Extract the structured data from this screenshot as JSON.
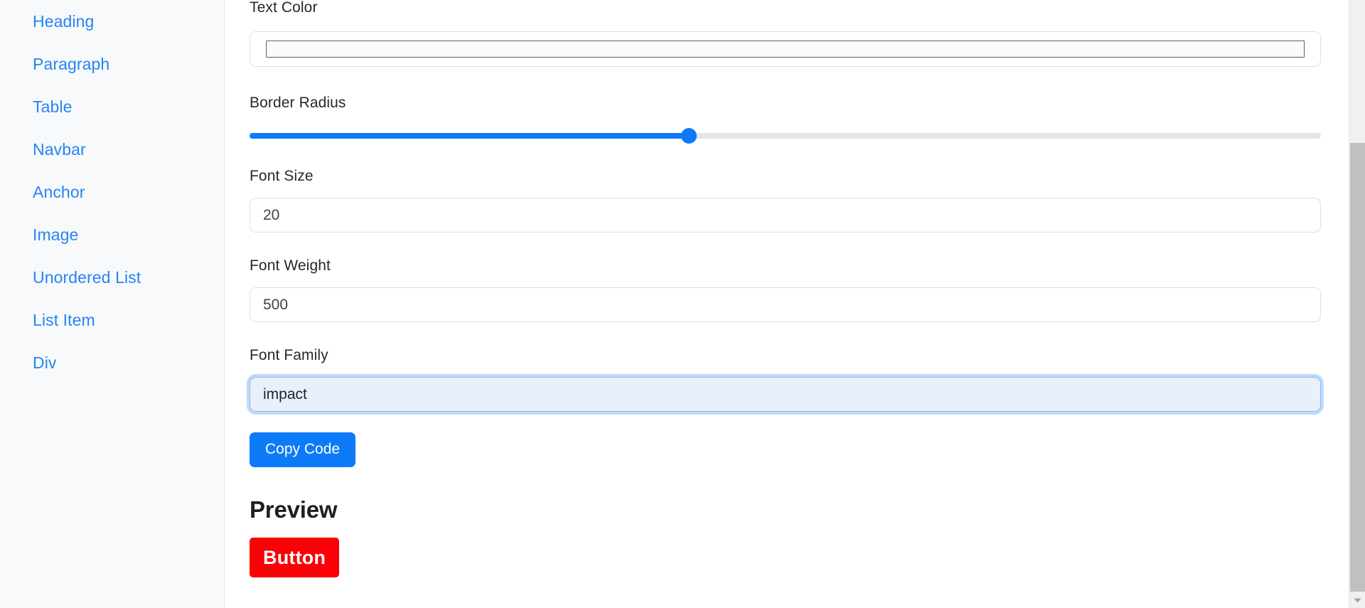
{
  "sidebar": {
    "items": [
      {
        "label": "Heading"
      },
      {
        "label": "Paragraph"
      },
      {
        "label": "Table"
      },
      {
        "label": "Navbar"
      },
      {
        "label": "Anchor"
      },
      {
        "label": "Image"
      },
      {
        "label": "Unordered List"
      },
      {
        "label": "List Item"
      },
      {
        "label": "Div"
      }
    ]
  },
  "form": {
    "text_color": {
      "label": "Text Color",
      "value": "#ffffff",
      "swatch_color": "#fafafa"
    },
    "border_radius": {
      "label": "Border Radius",
      "value": 50,
      "min": 0,
      "max": 100,
      "percent": 41,
      "fill_color": "#0d7bf7",
      "track_color": "#e4e5e7"
    },
    "font_size": {
      "label": "Font Size",
      "value": "20",
      "placeholder": "Font Size"
    },
    "font_weight": {
      "label": "Font Weight",
      "value": "500",
      "placeholder": "Font Weight"
    },
    "font_family": {
      "label": "Font Family",
      "value": "impact",
      "placeholder": "Font Family",
      "focused": true
    },
    "copy_button": {
      "label": "Copy Code",
      "color": "#0d7bf7"
    }
  },
  "preview": {
    "title": "Preview",
    "button_label": "Button",
    "button_bg": "#fb0007",
    "button_text_color": "#ffffff",
    "button_font_family": "impact",
    "button_font_size": "20",
    "button_font_weight": "500"
  },
  "scrollbar": {
    "thumb_color": "#c0c0c0",
    "track_color": "#f0f0f0",
    "arrow_down": "chevron-down"
  }
}
